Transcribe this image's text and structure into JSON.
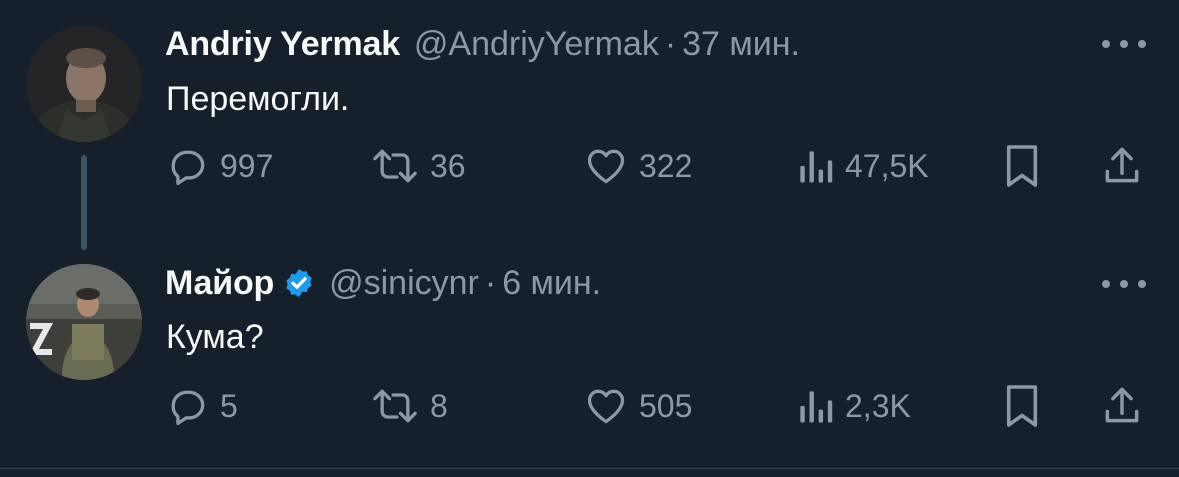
{
  "tweets": [
    {
      "author": {
        "name": "Andriy Yermak",
        "handle": "@AndriyYermak",
        "verified": false
      },
      "separator": "·",
      "time": "37 мин.",
      "text": "Перемогли.",
      "stats": {
        "replies": "997",
        "retweets": "36",
        "likes": "322",
        "views": "47,5K"
      }
    },
    {
      "author": {
        "name": "Майор",
        "handle": "@sinicynr",
        "verified": true
      },
      "separator": "·",
      "time": "6 мин.",
      "text": "Кума?",
      "stats": {
        "replies": "5",
        "retweets": "8",
        "likes": "505",
        "views": "2,3K"
      }
    }
  ],
  "colors": {
    "background": "#15202b",
    "primary_text": "#f7f9f9",
    "secondary_text": "#8b98a5",
    "verified_badge": "#1d9bf0",
    "thread_line": "#3d5466"
  },
  "icons": {
    "reply": "reply-icon",
    "retweet": "retweet-icon",
    "like": "heart-icon",
    "views": "views-icon",
    "bookmark": "bookmark-icon",
    "share": "share-icon",
    "more": "more-icon",
    "verified": "verified-badge-icon"
  }
}
